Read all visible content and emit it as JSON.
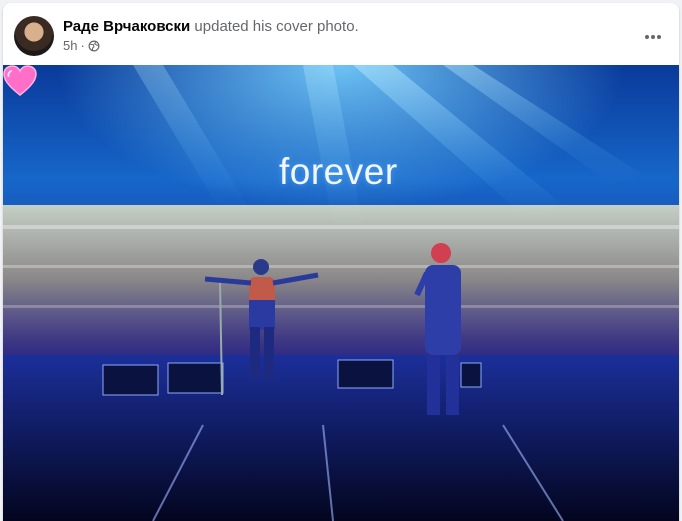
{
  "post": {
    "author": "Раде Врчаковски",
    "action": " updated his cover photo.",
    "time": "5h",
    "privacy_icon": "globe-icon",
    "more_icon": "more-options-icon"
  },
  "cover_photo": {
    "caption": "forever",
    "caption_emoji": "heart-icon",
    "colors": {
      "sky": "#1666c9",
      "crowd_lights": "#fff3b0",
      "stage": "#0b1f6b",
      "heart": "#ff6ec7"
    }
  }
}
